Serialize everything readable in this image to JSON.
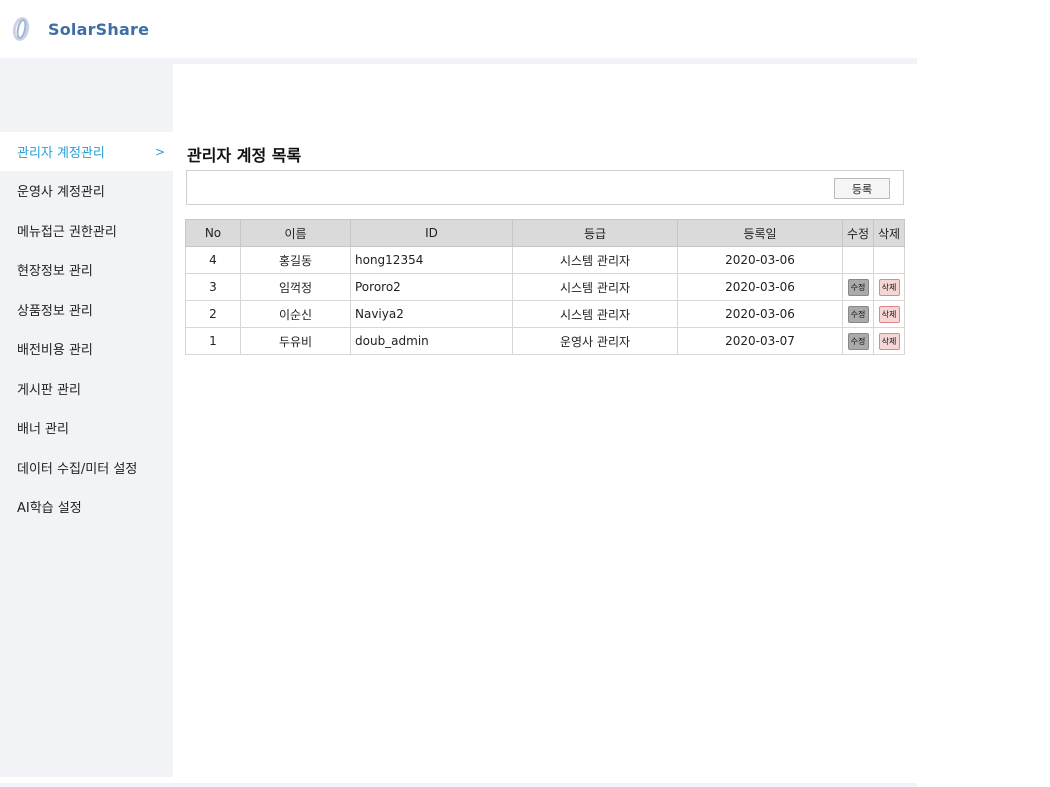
{
  "app": {
    "brand": "SolarShare"
  },
  "sidebar": {
    "items": [
      {
        "label": "관리자 계정관리",
        "active": true,
        "arrow": ">"
      },
      {
        "label": "운영사 계정관리"
      },
      {
        "label": "메뉴접근 권한관리"
      },
      {
        "label": "현장정보 관리"
      },
      {
        "label": "상품정보 관리"
      },
      {
        "label": "배전비용 관리"
      },
      {
        "label": "게시판 관리"
      },
      {
        "label": "배너 관리"
      },
      {
        "label": "데이터 수집/미터 설정"
      },
      {
        "label": "AI학습 설정"
      }
    ]
  },
  "main": {
    "title": "관리자 계정 목록",
    "register_label": "등록",
    "table": {
      "headers": [
        "No",
        "이름",
        "ID",
        "등급",
        "등록일",
        "수정",
        "삭제"
      ],
      "rows": [
        {
          "no": "4",
          "name": "홍길동",
          "id": "hong12354",
          "grade": "시스템 관리자",
          "date": "2020-03-06",
          "edit": "",
          "delete": ""
        },
        {
          "no": "3",
          "name": "임꺽정",
          "id": "Pororo2",
          "grade": "시스템 관리자",
          "date": "2020-03-06",
          "edit": "수정",
          "delete": "삭제"
        },
        {
          "no": "2",
          "name": "이순신",
          "id": "Naviya2",
          "grade": "시스템 관리자",
          "date": "2020-03-06",
          "edit": "수정",
          "delete": "삭제"
        },
        {
          "no": "1",
          "name": "두유비",
          "id": "doub_admin",
          "grade": "운영사 관리자",
          "date": "2020-03-07",
          "edit": "수정",
          "delete": "삭제"
        }
      ]
    }
  },
  "colors": {
    "accent": "#2a9fd6",
    "brand": "#3d6fa6",
    "sidebar_bg": "#f2f3f7",
    "delete_bg": "#f6d5d5"
  }
}
